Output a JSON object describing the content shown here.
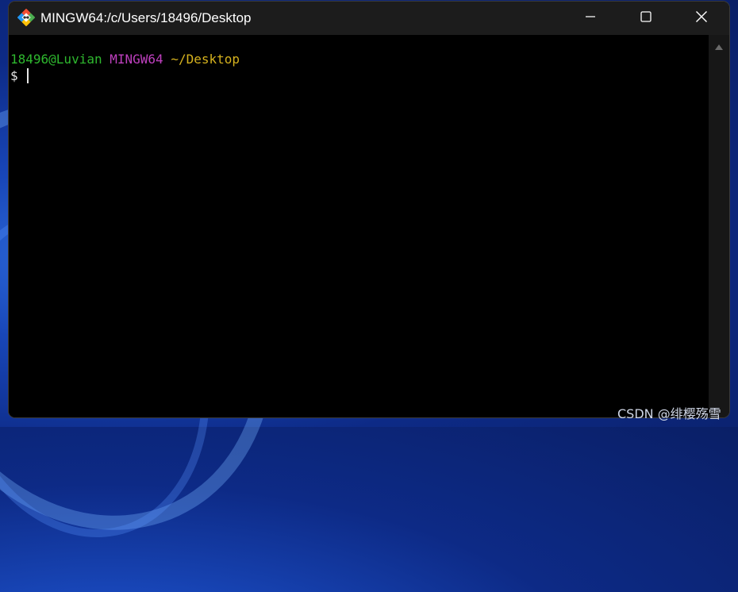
{
  "window": {
    "title": "MINGW64:/c/Users/18496/Desktop",
    "icon": "git-bash-icon",
    "controls": {
      "minimize": "minimize-icon",
      "maximize": "maximize-icon",
      "close": "close-icon"
    }
  },
  "terminal": {
    "prompt_user": "18496@Luvian",
    "prompt_host": "MINGW64",
    "prompt_path": "~/Desktop",
    "prompt_symbol": "$",
    "colors": {
      "user": "#2eb82e",
      "host": "#bf40bf",
      "path": "#d6b21e",
      "background": "#000000"
    }
  },
  "watermark": "CSDN @绯樱殇雪"
}
